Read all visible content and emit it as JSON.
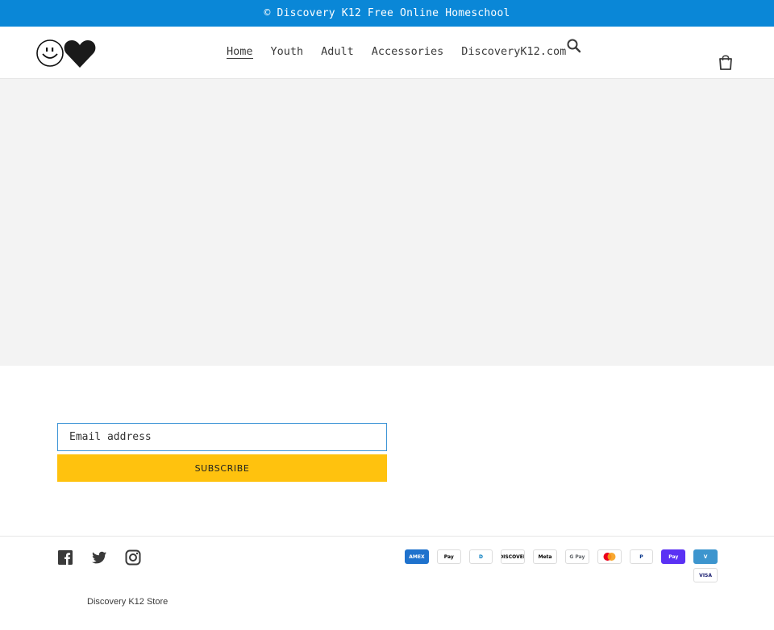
{
  "announcement": {
    "text": "© Discovery K12 Free Online Homeschool"
  },
  "header": {
    "logo_name": "smiley-heart-logo",
    "nav": [
      {
        "label": "Home",
        "active": true
      },
      {
        "label": "Youth"
      },
      {
        "label": "Adult"
      },
      {
        "label": "Accessories"
      },
      {
        "label": "DiscoveryK12.com"
      }
    ],
    "search_icon": "search-icon",
    "cart_icon": "cart-icon"
  },
  "newsletter": {
    "email_placeholder": "Email address",
    "subscribe_label": "SUBSCRIBE"
  },
  "footer": {
    "socials": [
      "facebook-icon",
      "twitter-icon",
      "instagram-icon"
    ],
    "payments": [
      {
        "name": "amex",
        "label": "AMEX",
        "bg": "#1f72cd",
        "fg": "#ffffff"
      },
      {
        "name": "apple-pay",
        "label": "Pay",
        "bg": "#ffffff",
        "fg": "#000000"
      },
      {
        "name": "diners-club",
        "label": "D",
        "bg": "#ffffff",
        "fg": "#0079be"
      },
      {
        "name": "discover",
        "label": "DISCOVER",
        "bg": "#ffffff",
        "fg": "#000000"
      },
      {
        "name": "meta-pay",
        "label": "Meta",
        "bg": "#ffffff",
        "fg": "#000000"
      },
      {
        "name": "google-pay",
        "label": "G Pay",
        "bg": "#ffffff",
        "fg": "#5f6368"
      },
      {
        "name": "mastercard",
        "label": "",
        "bg": "#ffffff",
        "fg": "#000000"
      },
      {
        "name": "paypal",
        "label": "P",
        "bg": "#ffffff",
        "fg": "#003087"
      },
      {
        "name": "shop-pay",
        "label": "Pay",
        "bg": "#5a31f4",
        "fg": "#ffffff"
      },
      {
        "name": "venmo",
        "label": "V",
        "bg": "#3d95ce",
        "fg": "#ffffff"
      },
      {
        "name": "visa",
        "label": "VISA",
        "bg": "#ffffff",
        "fg": "#1a1f71"
      }
    ],
    "copyright": "Discovery K12 Store"
  },
  "colors": {
    "accent": "#0a87d7",
    "subscribe": "#ffc20e",
    "hero": "#f3f3f3"
  }
}
